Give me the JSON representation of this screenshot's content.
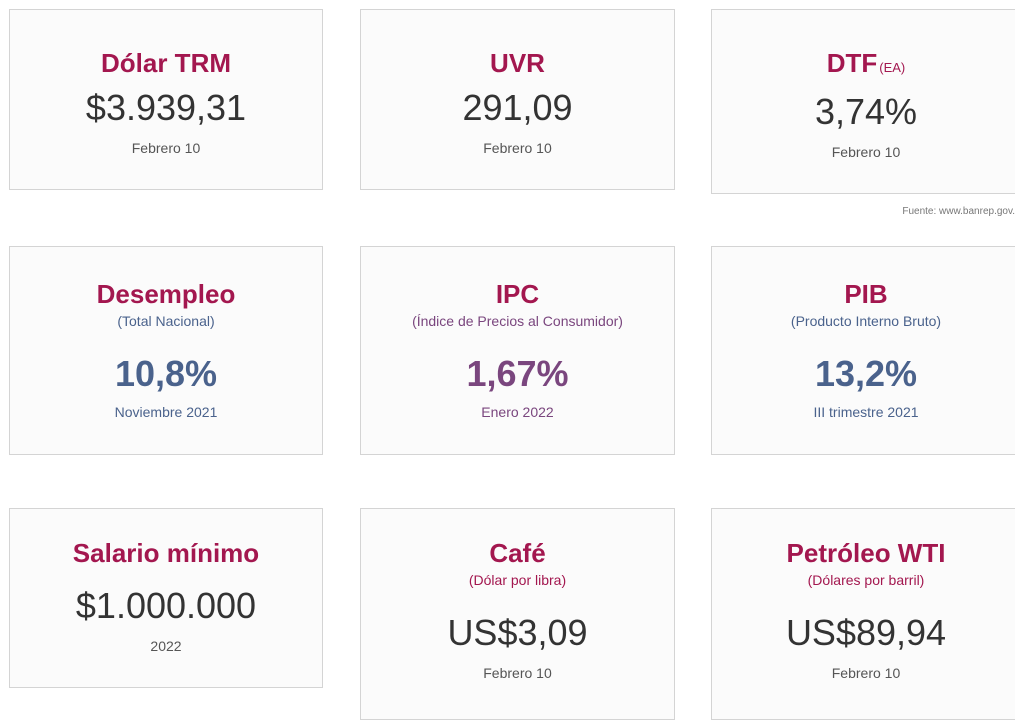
{
  "colors": {
    "title": "#a3174f",
    "blue": "#4a628c",
    "purple": "#7a467e",
    "dark": "#333333"
  },
  "source": "Fuente: www.banrep.gov.",
  "cards": [
    {
      "title": "Dólar TRM",
      "value": "$3.939,31",
      "date": "Febrero 10"
    },
    {
      "title": "UVR",
      "value": "291,09",
      "date": "Febrero 10"
    },
    {
      "title": "DTF",
      "tag": "(EA)",
      "value": "3,74%",
      "date": "Febrero 10"
    },
    {
      "title": "Desempleo",
      "subtitle": "(Total Nacional)",
      "value": "10,8%",
      "date": "Noviembre 2021"
    },
    {
      "title": "IPC",
      "subtitle": "(Índice de Precios al Consumidor)",
      "value": "1,67%",
      "date": "Enero 2022"
    },
    {
      "title": "PIB",
      "subtitle": "(Producto Interno Bruto)",
      "value": "13,2%",
      "date": "III trimestre 2021"
    },
    {
      "title": "Salario mínimo",
      "value": "$1.000.000",
      "date": "2022"
    },
    {
      "title": "Café",
      "subtitle": "(Dólar por libra)",
      "value": "US$3,09",
      "date": "Febrero 10"
    },
    {
      "title": "Petróleo WTI",
      "subtitle": "(Dólares por barril)",
      "value": "US$89,94",
      "date": "Febrero 10"
    }
  ]
}
